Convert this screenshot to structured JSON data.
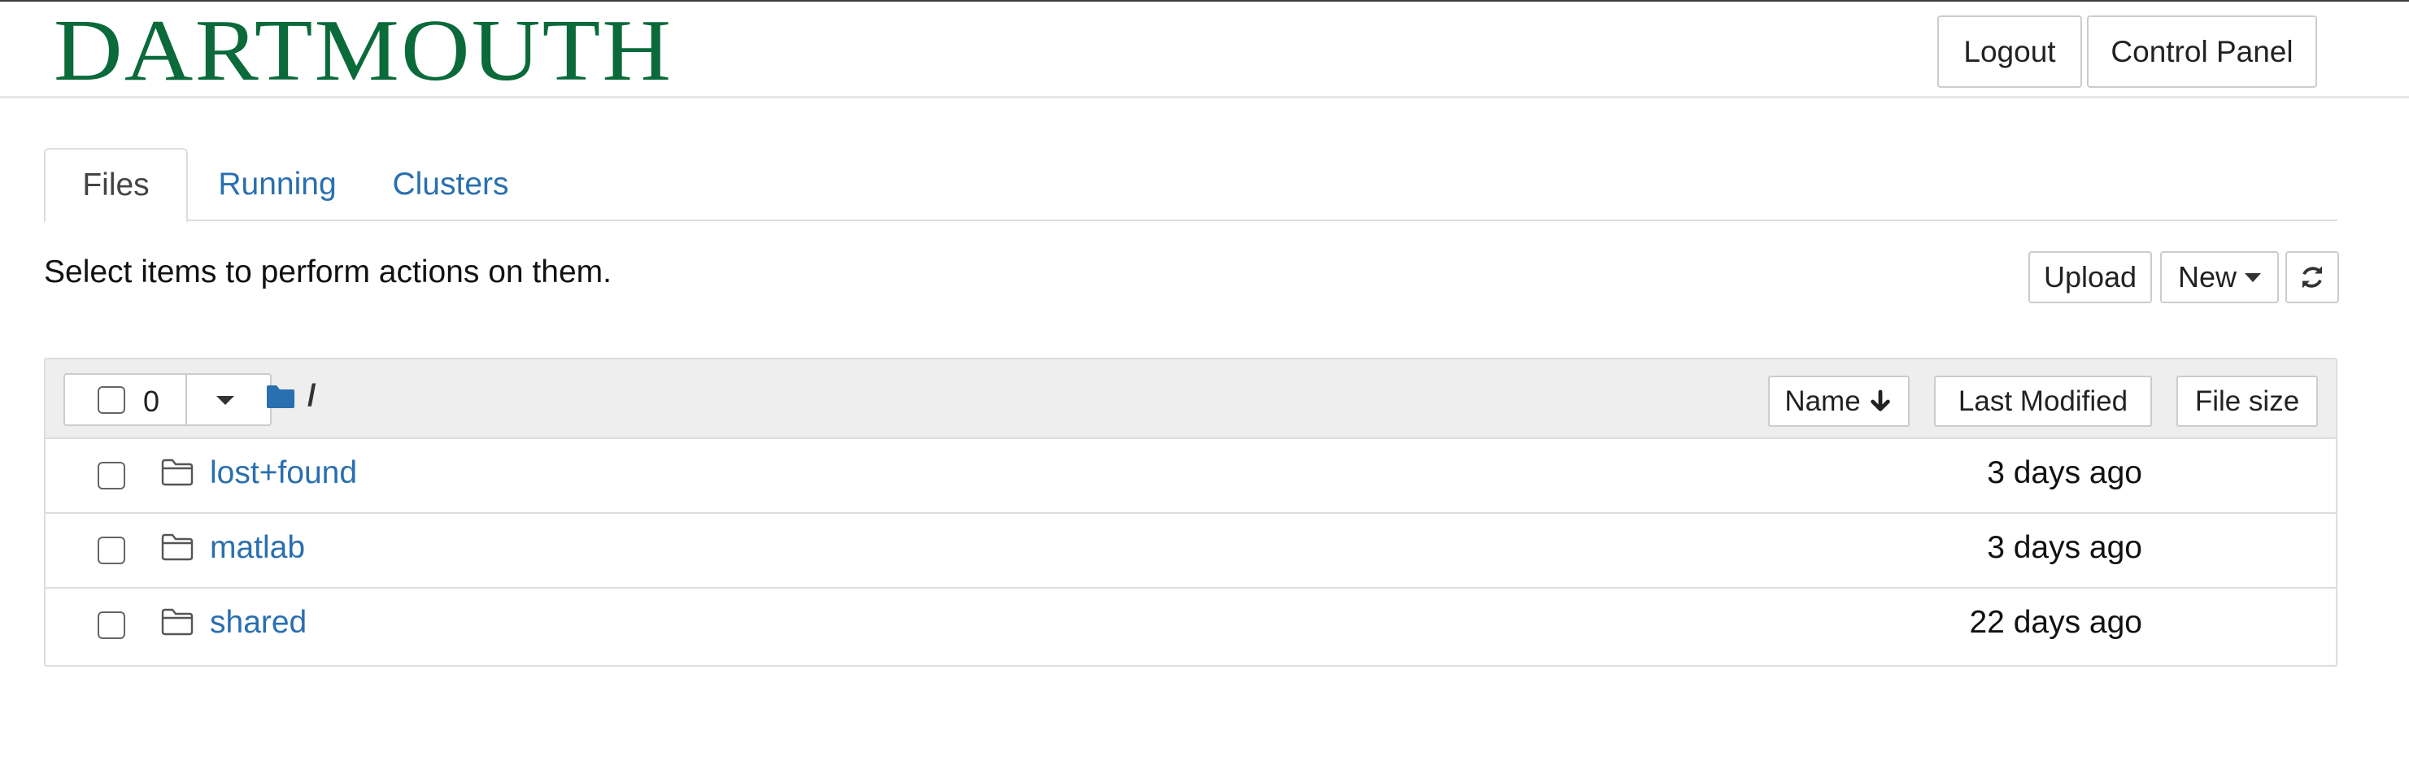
{
  "header": {
    "logo_text": "DARTMOUTH",
    "logout_label": "Logout",
    "control_panel_label": "Control Panel"
  },
  "tabs": [
    {
      "label": "Files",
      "active": true
    },
    {
      "label": "Running",
      "active": false
    },
    {
      "label": "Clusters",
      "active": false
    }
  ],
  "toolbar": {
    "hint": "Select items to perform actions on them.",
    "upload_label": "Upload",
    "new_label": "New",
    "refresh_icon": "refresh-icon"
  },
  "list_header": {
    "selected_count": "0",
    "breadcrumb_root": "/",
    "sort_name_label": "Name",
    "sort_name_icon": "arrow-down-icon",
    "last_modified_label": "Last Modified",
    "file_size_label": "File size"
  },
  "rows": [
    {
      "name": "lost+found",
      "modified": "3 days ago",
      "icon": "folder-icon"
    },
    {
      "name": "matlab",
      "modified": "3 days ago",
      "icon": "folder-icon"
    },
    {
      "name": "shared",
      "modified": "22 days ago",
      "icon": "folder-icon"
    }
  ],
  "colors": {
    "brand_green": "#0a6a3a",
    "link_blue": "#2a6fb0",
    "folder_blue": "#2a6fb0"
  }
}
